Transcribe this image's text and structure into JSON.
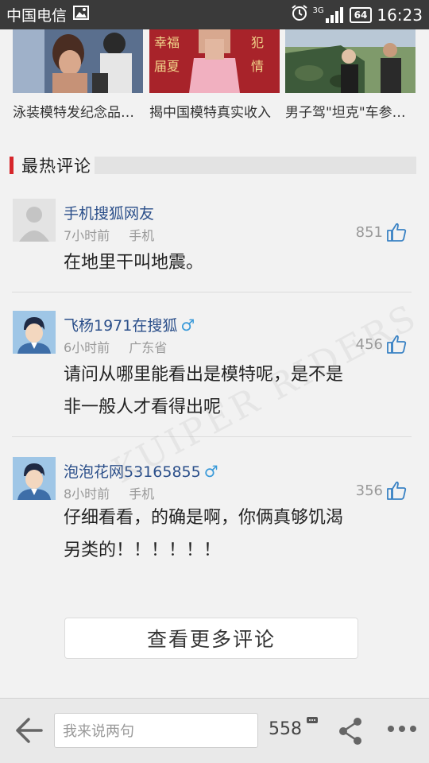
{
  "status_bar": {
    "carrier": "中国电信",
    "network": "3G",
    "battery": "64",
    "time": "16:23",
    "icons": [
      "image-icon",
      "alarm-icon",
      "signal-icon",
      "battery-icon"
    ]
  },
  "related": [
    {
      "caption": "泳装模特发纪念品…",
      "image": "event-photo"
    },
    {
      "caption": "揭中国模特真实收入",
      "image": "model-photo"
    },
    {
      "caption": "男子驾\"坦克\"车参赛…",
      "image": "tank-car-photo"
    }
  ],
  "section": {
    "title": "最热评论",
    "accent": "#d6262b"
  },
  "comments": [
    {
      "user": "手机搜狐网友",
      "time": "7小时前",
      "source": "手机",
      "likes": "851",
      "text_lines": [
        "在地里干叫地震。"
      ],
      "male": false,
      "avatar": "default-avatar"
    },
    {
      "user": "飞杨1971在搜狐",
      "time": "6小时前",
      "source": "广东省",
      "likes": "456",
      "text_lines": [
        "请问从哪里能看出是模特呢，是不是",
        "非一般人才看得出呢"
      ],
      "male": true,
      "avatar": "cartoon-avatar"
    },
    {
      "user": "泡泡花网53165855",
      "time": "8小时前",
      "source": "手机",
      "likes": "356",
      "text_lines": [
        "仔细看看，的确是啊，你俩真够饥渴",
        "另类的！！！！！！"
      ],
      "male": true,
      "avatar": "cartoon-avatar"
    }
  ],
  "male_symbol": "♂",
  "more_button": "查看更多评论",
  "bottom_bar": {
    "input_placeholder": "我来说两句",
    "comment_count": "558"
  },
  "watermark": "KUIPER RIDERS"
}
